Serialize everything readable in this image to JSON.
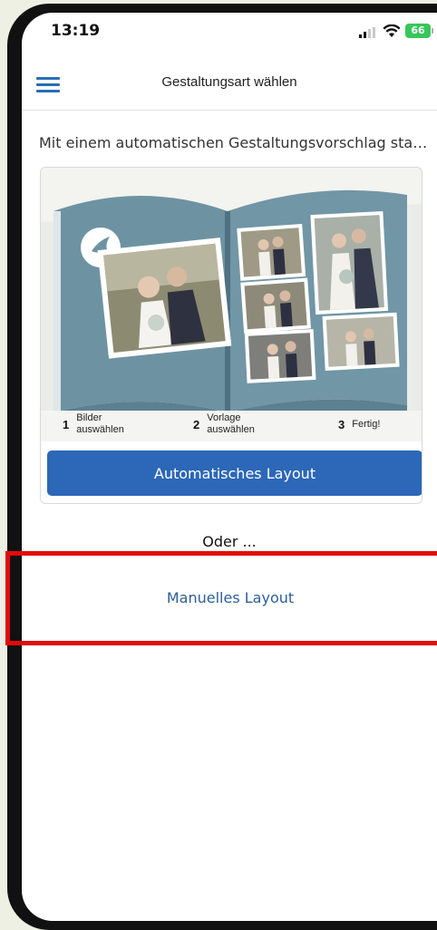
{
  "status_bar": {
    "time": "13:19",
    "battery": "66"
  },
  "header": {
    "menu_icon": "hamburger-menu-icon",
    "title": "Gestaltungsart wählen"
  },
  "subtitle": "Mit einem automatischen Gestaltungsvorschlag star…",
  "card": {
    "image_description_icon": "photo-book-illustration",
    "steps": [
      {
        "number": "1",
        "label": "Bilder\nauswählen"
      },
      {
        "number": "2",
        "label": "Vorlage\nauswählen"
      },
      {
        "number": "3",
        "label": "Fertig!"
      }
    ],
    "button_label": "Automatisches Layout"
  },
  "or_text": "Oder ...",
  "manual_button_label": "Manuelles Layout",
  "colors": {
    "accent": "#2c67b8",
    "link": "#2c5f9a",
    "highlight": "#e10b0b",
    "album_blue": "#6d93a3"
  }
}
